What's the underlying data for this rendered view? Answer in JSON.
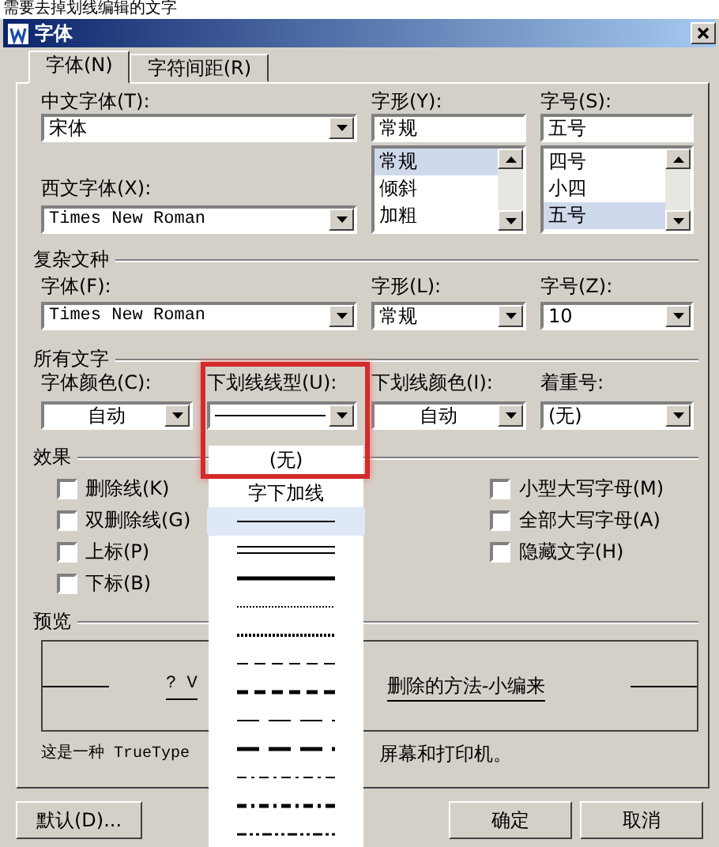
{
  "caption": "需要去掉划线编辑的文字",
  "window": {
    "title": "字体"
  },
  "tabs": [
    {
      "label": "字体(N)",
      "selected": true
    },
    {
      "label": "字符间距(R)",
      "selected": false
    }
  ],
  "chinese_font": {
    "label": "中文字体(T):",
    "value": "宋体"
  },
  "font_style": {
    "label": "字形(Y):",
    "value": "常规",
    "options": [
      {
        "label": "常规",
        "selected": true
      },
      {
        "label": "倾斜",
        "selected": false
      },
      {
        "label": "加粗",
        "selected": false
      }
    ]
  },
  "font_size": {
    "label": "字号(S):",
    "value": "五号",
    "options": [
      {
        "label": "四号",
        "selected": false
      },
      {
        "label": "小四",
        "selected": false
      },
      {
        "label": "五号",
        "selected": true
      }
    ]
  },
  "western_font": {
    "label": "西文字体(X):",
    "value": "Times New Roman"
  },
  "complex_script": {
    "heading": "复杂文种",
    "fields": [
      {
        "label": "字体(F):",
        "value": "Times New Roman"
      },
      {
        "label": "字形(L):",
        "value": "常规"
      },
      {
        "label": "字号(Z):",
        "value": "10"
      }
    ]
  },
  "all_text": {
    "heading": "所有文字",
    "fields": [
      {
        "kind": "centered",
        "label": "字体颜色(C):",
        "value": "自动"
      },
      {
        "kind": "line",
        "label": "下划线线型(U):"
      },
      {
        "kind": "centered",
        "label": "下划线颜色(I):",
        "value": "自动"
      },
      {
        "kind": "text",
        "label": "着重号:",
        "value": "(无)"
      }
    ]
  },
  "effects": {
    "heading": "效果",
    "left": [
      {
        "label": "删除线(K)",
        "checked": false
      },
      {
        "label": "双删除线(G)",
        "checked": false
      },
      {
        "label": "上标(P)",
        "checked": false
      },
      {
        "label": "下标(B)",
        "checked": false
      }
    ],
    "right": [
      {
        "label": "小型大写字母(M)",
        "checked": false
      },
      {
        "label": "全部大写字母(A)",
        "checked": false
      },
      {
        "label": "隐藏文字(H)",
        "checked": false
      }
    ]
  },
  "preview": {
    "heading": "预览",
    "text_parts": [
      "? V",
      "删除的方法-小编来"
    ],
    "note_parts": [
      "这是一种 TrueType",
      "屏幕和打印机。"
    ]
  },
  "buttons": [
    {
      "label": "默认(D)..."
    },
    {
      "label": "确定"
    },
    {
      "label": "取消"
    }
  ],
  "highlight_frame": true,
  "underline_dropdown": {
    "items": [
      {
        "kind": "text",
        "label": "(无)",
        "selected": false
      },
      {
        "kind": "text",
        "label": "字下加线",
        "selected": false
      },
      {
        "kind": "single",
        "selected": true
      },
      {
        "kind": "double",
        "selected": false
      },
      {
        "kind": "thick",
        "selected": false
      },
      {
        "kind": "dotted",
        "selected": false
      },
      {
        "kind": "dotted-heavy",
        "selected": false
      },
      {
        "kind": "dash",
        "selected": false
      },
      {
        "kind": "dash-heavy",
        "selected": false
      },
      {
        "kind": "long-dash",
        "selected": false
      },
      {
        "kind": "long-dash-heavy",
        "selected": false
      },
      {
        "kind": "dot-dash",
        "selected": false
      },
      {
        "kind": "dot-dash-heavy",
        "selected": false
      },
      {
        "kind": "dot-dot-dash",
        "selected": false
      }
    ]
  }
}
